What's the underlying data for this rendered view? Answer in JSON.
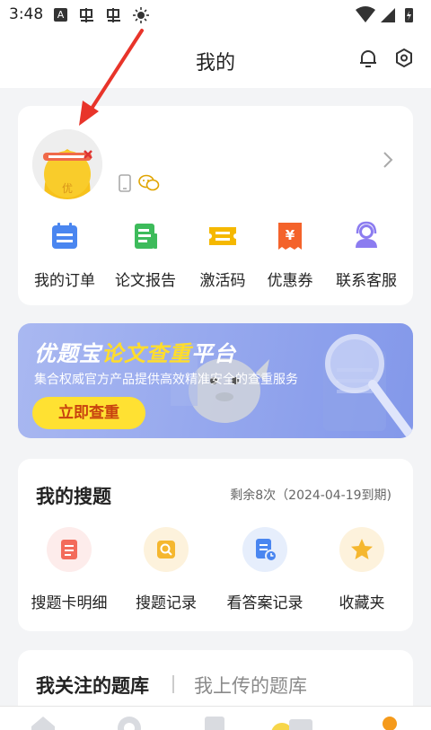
{
  "status_bar": {
    "time": "3:48"
  },
  "header": {
    "title": "我的"
  },
  "quick_actions": [
    {
      "label": "我的订单",
      "icon": "orders-icon",
      "color": "#4a86f0"
    },
    {
      "label": "论文报告",
      "icon": "report-icon",
      "color": "#3dbb5b"
    },
    {
      "label": "激活码",
      "icon": "activation-code-icon",
      "color": "#f5b800"
    },
    {
      "label": "优惠券",
      "icon": "coupon-icon",
      "color": "#f4632b"
    },
    {
      "label": "联系客服",
      "icon": "customer-service-icon",
      "color": "#8c7cf0"
    }
  ],
  "banner": {
    "title_part1": "优题宝",
    "title_highlight": "论文查重",
    "title_part2": "平台",
    "subtitle": "集合权威官方产品提供高效精准安全的查重服务",
    "button_label": "立即查重"
  },
  "my_search": {
    "title": "我的搜题",
    "remaining": "剩余8次（2024-04-19到期)",
    "items": [
      {
        "label": "搜题卡明细",
        "icon": "search-card-detail-icon",
        "bg": "#fdeceb",
        "color": "#f36b5b"
      },
      {
        "label": "搜题记录",
        "icon": "search-record-icon",
        "bg": "#fdf2dc",
        "color": "#f5b72f"
      },
      {
        "label": "看答案记录",
        "icon": "answer-record-icon",
        "bg": "#e6eefc",
        "color": "#4a86f0"
      },
      {
        "label": "收藏夹",
        "icon": "favorites-star-icon",
        "bg": "#fdf2dc",
        "color": "#f5b72f"
      }
    ]
  },
  "libraries": {
    "tab_followed": "我关注的题库",
    "tab_uploaded": "我上传的题库"
  },
  "colors": {
    "accent": "#f5b800",
    "background": "#f3f4f6",
    "banner_button": "#ffe132",
    "arrow": "#e8342a"
  }
}
